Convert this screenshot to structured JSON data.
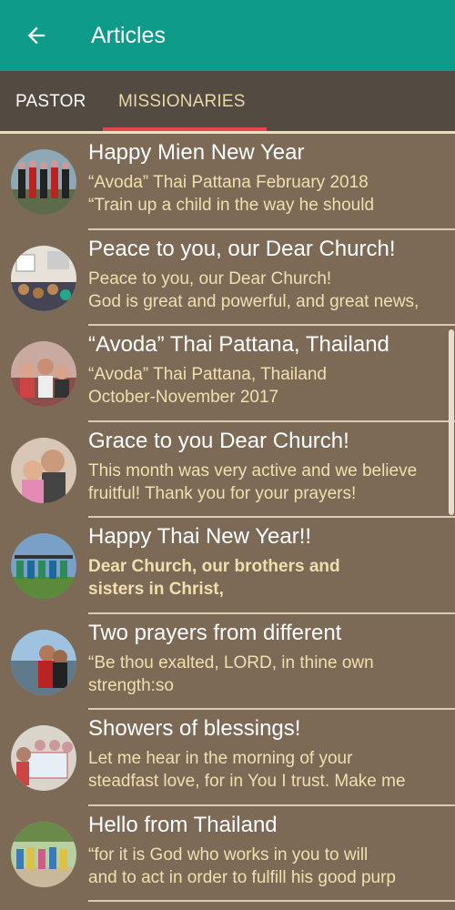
{
  "appbar": {
    "title": "Articles",
    "back_icon": "arrow-left-icon",
    "color": "#0f9b8a"
  },
  "tabs": [
    {
      "label": "PASTOR",
      "selected": false
    },
    {
      "label": "MISSIONARIES",
      "selected": true
    }
  ],
  "colors": {
    "tab_indicator": "#e2474e",
    "background": "#7d6a56",
    "tabbar": "#534a42",
    "subtitle": "#f2dfb0"
  },
  "articles": [
    {
      "title": "Happy Mien New Year",
      "line1": "“Avoda” Thai Pattana    February 2018",
      "line2": " “Train up a child in the way he should",
      "bold": false
    },
    {
      "title": "Peace to you, our Dear Church!",
      "line1": "Peace to you, our Dear Church!",
      "line2": "God is great and powerful, and great news,",
      "bold": false
    },
    {
      "title": "“Avoda” Thai Pattana, Thailand",
      "line1": "“Avoda” Thai Pattana, Thailand",
      "line2": "October-November 2017",
      "bold": false
    },
    {
      "title": "Grace to you Dear Church!",
      "line1": "This month was very active and we believe",
      "line2": "fruitful! Thank you for your prayers!",
      "bold": false
    },
    {
      "title": "Happy Thai New Year!!",
      "line1": "Dear Church, our brothers and",
      "line2": "sisters in Christ,",
      "bold": true
    },
    {
      "title": "Two prayers from different",
      "line1": "“Be thou exalted, LORD, in thine own",
      "line2": "strength:so",
      "bold": false
    },
    {
      "title": "Showers of blessings!",
      "line1": "Let me hear in the morning of your",
      "line2": "steadfast love, for in You I trust. Make me",
      "bold": false
    },
    {
      "title": "Hello from Thailand",
      "line1": "“for it is God who works in you to will",
      "line2": "and to act in order to fulfill his good purp",
      "bold": false
    }
  ]
}
